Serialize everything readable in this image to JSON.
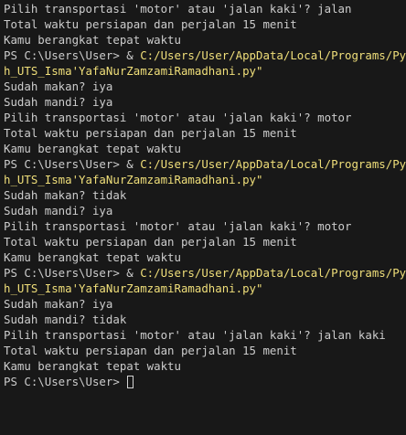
{
  "terminal": {
    "lines": [
      {
        "type": "output",
        "text": "Pilih transportasi 'motor' atau 'jalan kaki'? jalan"
      },
      {
        "type": "output",
        "text": "Total waktu persiapan dan perjalan 15 menit"
      },
      {
        "type": "output",
        "text": "Kamu berangkat tepat waktu"
      },
      {
        "type": "command",
        "prompt": "PS C:\\Users\\User> ",
        "amp": "& ",
        "cmd": "C:/Users/User/AppData/Local/Programs/Python"
      },
      {
        "type": "cmd-cont",
        "cmd": "h_UTS_Isma'YafaNurZamzamiRamadhani.py\""
      },
      {
        "type": "output",
        "text": "Sudah makan? iya"
      },
      {
        "type": "output",
        "text": "Sudah mandi? iya"
      },
      {
        "type": "output",
        "text": "Pilih transportasi 'motor' atau 'jalan kaki'? motor"
      },
      {
        "type": "output",
        "text": "Total waktu persiapan dan perjalan 15 menit"
      },
      {
        "type": "output",
        "text": "Kamu berangkat tepat waktu"
      },
      {
        "type": "command",
        "prompt": "PS C:\\Users\\User> ",
        "amp": "& ",
        "cmd": "C:/Users/User/AppData/Local/Programs/Python"
      },
      {
        "type": "cmd-cont",
        "cmd": "h_UTS_Isma'YafaNurZamzamiRamadhani.py\""
      },
      {
        "type": "output",
        "text": "Sudah makan? tidak"
      },
      {
        "type": "output",
        "text": "Sudah mandi? iya"
      },
      {
        "type": "output",
        "text": "Pilih transportasi 'motor' atau 'jalan kaki'? motor"
      },
      {
        "type": "output",
        "text": "Total waktu persiapan dan perjalan 15 menit"
      },
      {
        "type": "output",
        "text": "Kamu berangkat tepat waktu"
      },
      {
        "type": "command",
        "prompt": "PS C:\\Users\\User> ",
        "amp": "& ",
        "cmd": "C:/Users/User/AppData/Local/Programs/Python"
      },
      {
        "type": "cmd-cont",
        "cmd": "h_UTS_Isma'YafaNurZamzamiRamadhani.py\""
      },
      {
        "type": "output",
        "text": "Sudah makan? iya"
      },
      {
        "type": "output",
        "text": "Sudah mandi? tidak"
      },
      {
        "type": "output",
        "text": "Pilih transportasi 'motor' atau 'jalan kaki'? jalan kaki"
      },
      {
        "type": "output",
        "text": "Total waktu persiapan dan perjalan 15 menit"
      },
      {
        "type": "output",
        "text": "Kamu berangkat tepat waktu"
      }
    ],
    "final_prompt": "PS C:\\Users\\User> "
  },
  "colors": {
    "background": "#181818",
    "text": "#cccccc",
    "command": "#f0df7a"
  }
}
